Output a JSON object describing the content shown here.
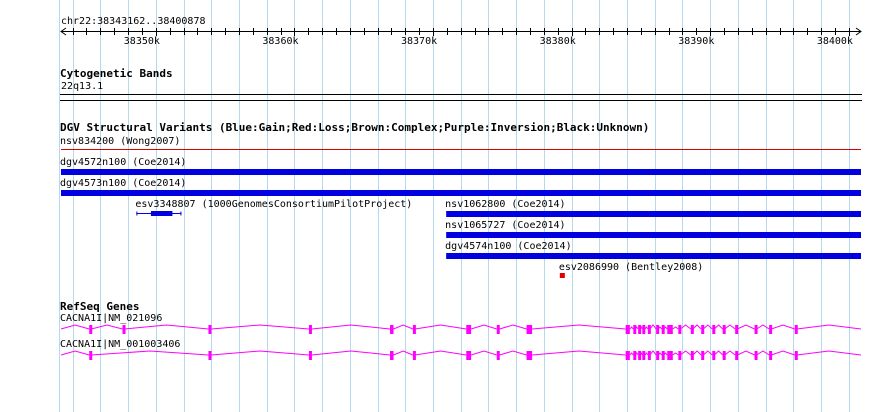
{
  "region": {
    "label": "chr22:38343162..38400878",
    "start": 38343162,
    "end": 38400878,
    "ticks": [
      {
        "pos": 38350000,
        "label": "38350k"
      },
      {
        "pos": 38360000,
        "label": "38360k"
      },
      {
        "pos": 38370000,
        "label": "38370k"
      },
      {
        "pos": 38380000,
        "label": "38380k"
      },
      {
        "pos": 38390000,
        "label": "38390k"
      },
      {
        "pos": 38400000,
        "label": "38400k"
      }
    ]
  },
  "colors": {
    "gain": "#0000e0",
    "loss": "#e00000",
    "refseq": "#ff00ff",
    "grid": "#b4d8ee"
  },
  "tracks": {
    "cytoband": {
      "title": "Cytogenetic Bands",
      "band_label": "22q13.1"
    },
    "dgv": {
      "title": "DGV Structural Variants (Blue:Gain;Red:Loss;Brown:Complex;Purple:Inversion;Black:Unknown)",
      "features": [
        {
          "name": "nsv834200 (Wong2007)",
          "start": 38343162,
          "end": 38400878,
          "type": "loss",
          "style": "thin"
        },
        {
          "name": "dgv4572n100 (Coe2014)",
          "start": 38343162,
          "end": 38400878,
          "type": "gain",
          "style": "bar"
        },
        {
          "name": "dgv4573n100 (Coe2014)",
          "start": 38343162,
          "end": 38400878,
          "type": "gain",
          "style": "bar"
        },
        {
          "name": "esv3348807 (1000GenomesConsortiumPilotProject)",
          "start": 38348600,
          "end": 38351850,
          "inner_start": 38349650,
          "inner_end": 38351200,
          "type": "gain",
          "style": "bracket"
        },
        {
          "name": "nsv1062800 (Coe2014)",
          "start": 38370950,
          "end": 38400878,
          "type": "gain",
          "style": "bar"
        },
        {
          "name": "nsv1065727 (Coe2014)",
          "start": 38370950,
          "end": 38400878,
          "type": "gain",
          "style": "bar"
        },
        {
          "name": "dgv4574n100 (Coe2014)",
          "start": 38370950,
          "end": 38400878,
          "type": "gain",
          "style": "bar"
        },
        {
          "name": "esv2086990 (Bentley2008)",
          "start": 38379150,
          "end": 38379450,
          "type": "loss",
          "style": "box"
        }
      ]
    },
    "refseq": {
      "title": "RefSeq Genes",
      "transcripts": [
        {
          "name": "CACNA1I|NM_021096",
          "start": 38343162,
          "end": 38400878,
          "exons": [
            [
              38345200,
              38345350
            ],
            [
              38347600,
              38347750
            ],
            [
              38353800,
              38354000
            ],
            [
              38361050,
              38361250
            ],
            [
              38366900,
              38367150
            ],
            [
              38368550,
              38368700
            ],
            [
              38372400,
              38372750
            ],
            [
              38374600,
              38374800
            ],
            [
              38376750,
              38377150
            ],
            [
              38383900,
              38384200
            ],
            [
              38384450,
              38384600
            ],
            [
              38384800,
              38384950
            ],
            [
              38385100,
              38385300
            ],
            [
              38385500,
              38385650
            ],
            [
              38386100,
              38386250
            ],
            [
              38386500,
              38386650
            ],
            [
              38386900,
              38387300
            ],
            [
              38387700,
              38387850
            ],
            [
              38388600,
              38388750
            ],
            [
              38389350,
              38389500
            ],
            [
              38390150,
              38390300
            ],
            [
              38390900,
              38391050
            ],
            [
              38391800,
              38391950
            ],
            [
              38393200,
              38393350
            ],
            [
              38394250,
              38394400
            ],
            [
              38396100,
              38396250
            ]
          ]
        },
        {
          "name": "CACNA1I|NM_001003406",
          "start": 38343162,
          "end": 38400878,
          "exons": [
            [
              38345200,
              38345350
            ],
            [
              38353800,
              38354000
            ],
            [
              38361050,
              38361250
            ],
            [
              38366900,
              38367150
            ],
            [
              38368550,
              38368700
            ],
            [
              38372400,
              38372750
            ],
            [
              38374600,
              38374800
            ],
            [
              38376750,
              38377150
            ],
            [
              38383900,
              38384200
            ],
            [
              38384450,
              38384600
            ],
            [
              38384800,
              38384950
            ],
            [
              38385100,
              38385300
            ],
            [
              38385500,
              38385650
            ],
            [
              38386100,
              38386250
            ],
            [
              38386500,
              38386650
            ],
            [
              38386900,
              38387300
            ],
            [
              38387700,
              38387850
            ],
            [
              38388600,
              38388750
            ],
            [
              38389350,
              38389500
            ],
            [
              38390150,
              38390300
            ],
            [
              38390900,
              38391050
            ],
            [
              38391800,
              38391950
            ],
            [
              38393200,
              38393350
            ],
            [
              38394250,
              38394400
            ],
            [
              38396100,
              38396250
            ]
          ]
        }
      ]
    }
  }
}
